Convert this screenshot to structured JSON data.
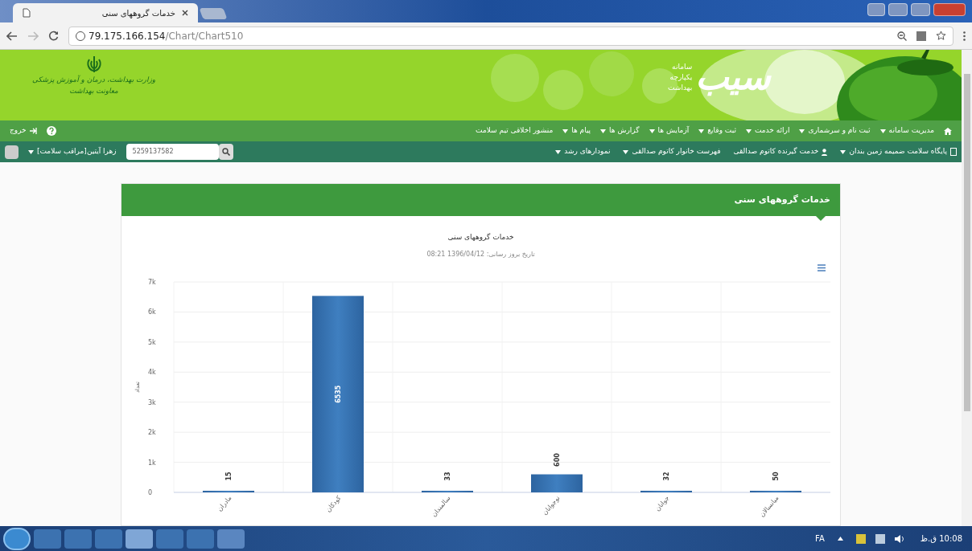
{
  "browser": {
    "tab_title": "خدمات گروههای سنی",
    "url_host": "79.175.166.154",
    "url_path": "/Chart/Chart510"
  },
  "header": {
    "ministry_lines": [
      "وزارت بهداشت، درمان و آموزش پزشکی",
      "معاونت بهداشت"
    ],
    "system_lines": [
      "سامانه",
      "یکپارچه",
      "بهداشت"
    ],
    "logo_text": "سیب"
  },
  "menu": {
    "items": [
      {
        "label": "مدیریت سامانه",
        "dropdown": true
      },
      {
        "label": "ثبت نام و سرشماری",
        "dropdown": true
      },
      {
        "label": "ارائه خدمت",
        "dropdown": true
      },
      {
        "label": "ثبت وقایع",
        "dropdown": true
      },
      {
        "label": "آزمایش ها",
        "dropdown": true
      },
      {
        "label": "گزارش ها",
        "dropdown": true
      },
      {
        "label": "پیام ها",
        "dropdown": true
      },
      {
        "label": "منشور اخلاقی تیم سلامت",
        "dropdown": false
      }
    ],
    "logout": "خروج"
  },
  "submenu": {
    "items": [
      {
        "label": "پایگاه سلامت ضمیمه زمین بندان",
        "kind": "building",
        "dropdown": true
      },
      {
        "label": "خدمت گیرنده کاتوم صدالقی",
        "kind": "person",
        "dropdown": false
      },
      {
        "label": "فهرست خانوار کاتوم صدالقی",
        "kind": "plain",
        "dropdown": true
      },
      {
        "label": "نمودارهای رشد",
        "kind": "plain",
        "dropdown": true
      }
    ],
    "user": "زهرا آیتین[مراقب سلامت]",
    "search_value": "5259137582"
  },
  "panel": {
    "title": "خدمات گروههای سنی",
    "subtitle": "تاریخ بروز رسانی: 1396/04/12 08:21",
    "chart_data": {
      "type": "bar",
      "title": "خدمات گروههای سنی",
      "ylabel": "تعداد",
      "categories": [
        "مادران",
        "کودکان",
        "سالمندان",
        "نوجوانان",
        "جوانان",
        "میانسالان"
      ],
      "series": [
        {
          "color": "#3f7fc0",
          "values": [
            15,
            6535,
            33,
            600,
            32,
            50
          ]
        }
      ],
      "grid": true,
      "ylim": [
        0,
        7000
      ],
      "yticks": [
        {
          "value": 0,
          "label": "0"
        },
        {
          "value": 1000,
          "label": "1k"
        },
        {
          "value": 2000,
          "label": "2k"
        },
        {
          "value": 3000,
          "label": "3k"
        },
        {
          "value": 4000,
          "label": "4k"
        },
        {
          "value": 5000,
          "label": "5k"
        },
        {
          "value": 6000,
          "label": "6k"
        },
        {
          "value": 7000,
          "label": "7k"
        }
      ],
      "data_labels": true
    }
  },
  "taskbar": {
    "language": "FA",
    "time": "10:08 ق.ظ"
  }
}
